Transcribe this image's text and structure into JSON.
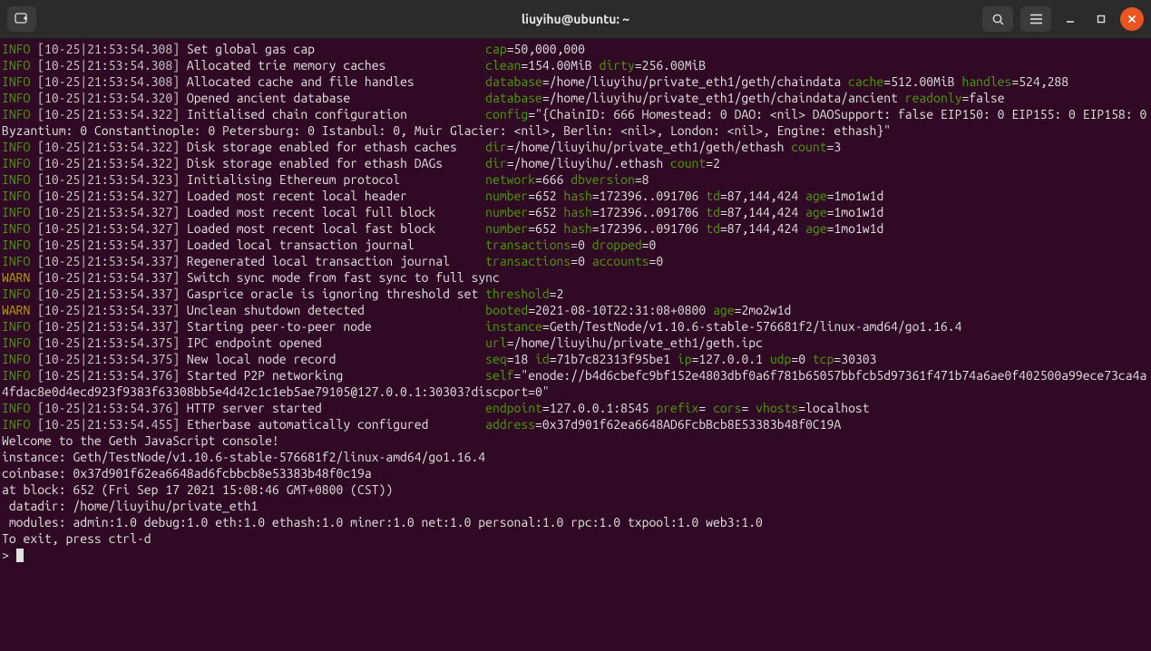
{
  "titlebar": {
    "title": "liuyihu@ubuntu: ~"
  },
  "log": [
    {
      "lvl": "INFO",
      "ts": "[10-25|21:53:54.308]",
      "msg": "Set global gas cap",
      "kv": [
        [
          "cap",
          "50,000,000"
        ]
      ]
    },
    {
      "lvl": "INFO",
      "ts": "[10-25|21:53:54.308]",
      "msg": "Allocated trie memory caches",
      "kv": [
        [
          "clean",
          "154.00MiB"
        ],
        [
          "dirty",
          "256.00MiB"
        ]
      ]
    },
    {
      "lvl": "INFO",
      "ts": "[10-25|21:53:54.308]",
      "msg": "Allocated cache and file handles",
      "kv": [
        [
          "database",
          "/home/liuyihu/private_eth1/geth/chaindata"
        ],
        [
          "cache",
          "512.00MiB"
        ],
        [
          "handles",
          "524,288"
        ]
      ]
    },
    {
      "lvl": "INFO",
      "ts": "[10-25|21:53:54.320]",
      "msg": "Opened ancient database",
      "kv": [
        [
          "database",
          "/home/liuyihu/private_eth1/geth/chaindata/ancient"
        ],
        [
          "readonly",
          "false"
        ]
      ]
    },
    {
      "lvl": "INFO",
      "ts": "[10-25|21:53:54.322]",
      "msg": "Initialised chain configuration",
      "kv": [
        [
          "config",
          "\"{ChainID: 666 Homestead: 0 DAO: <nil> DAOSupport: false EIP150: 0 EIP155: 0 EIP158: 0 Byzantium: 0 Constantinople: 0 Petersburg: 0 Istanbul: 0, Muir Glacier: <nil>, Berlin: <nil>, London: <nil>, Engine: ethash}\""
        ]
      ]
    },
    {
      "lvl": "INFO",
      "ts": "[10-25|21:53:54.322]",
      "msg": "Disk storage enabled for ethash caches",
      "kv": [
        [
          "dir",
          "/home/liuyihu/private_eth1/geth/ethash"
        ],
        [
          "count",
          "3"
        ]
      ]
    },
    {
      "lvl": "INFO",
      "ts": "[10-25|21:53:54.322]",
      "msg": "Disk storage enabled for ethash DAGs",
      "kv": [
        [
          "dir",
          "/home/liuyihu/.ethash"
        ],
        [
          "count",
          "2"
        ]
      ]
    },
    {
      "lvl": "INFO",
      "ts": "[10-25|21:53:54.323]",
      "msg": "Initialising Ethereum protocol",
      "kv": [
        [
          "network",
          "666"
        ],
        [
          "dbversion",
          "8"
        ]
      ]
    },
    {
      "lvl": "INFO",
      "ts": "[10-25|21:53:54.327]",
      "msg": "Loaded most recent local header",
      "kv": [
        [
          "number",
          "652"
        ],
        [
          "hash",
          "172396..091706"
        ],
        [
          "td",
          "87,144,424"
        ],
        [
          "age",
          "1mo1w1d"
        ]
      ]
    },
    {
      "lvl": "INFO",
      "ts": "[10-25|21:53:54.327]",
      "msg": "Loaded most recent local full block",
      "kv": [
        [
          "number",
          "652"
        ],
        [
          "hash",
          "172396..091706"
        ],
        [
          "td",
          "87,144,424"
        ],
        [
          "age",
          "1mo1w1d"
        ]
      ]
    },
    {
      "lvl": "INFO",
      "ts": "[10-25|21:53:54.327]",
      "msg": "Loaded most recent local fast block",
      "kv": [
        [
          "number",
          "652"
        ],
        [
          "hash",
          "172396..091706"
        ],
        [
          "td",
          "87,144,424"
        ],
        [
          "age",
          "1mo1w1d"
        ]
      ]
    },
    {
      "lvl": "INFO",
      "ts": "[10-25|21:53:54.337]",
      "msg": "Loaded local transaction journal",
      "kv": [
        [
          "transactions",
          "0"
        ],
        [
          "dropped",
          "0"
        ]
      ]
    },
    {
      "lvl": "INFO",
      "ts": "[10-25|21:53:54.337]",
      "msg": "Regenerated local transaction journal",
      "kv": [
        [
          "transactions",
          "0"
        ],
        [
          "accounts",
          "0"
        ]
      ]
    },
    {
      "lvl": "WARN",
      "ts": "[10-25|21:53:54.337]",
      "msg": "Switch sync mode from fast sync to full sync",
      "kv": []
    },
    {
      "lvl": "INFO",
      "ts": "[10-25|21:53:54.337]",
      "msg": "Gasprice oracle is ignoring threshold set",
      "kv": [
        [
          "threshold",
          "2"
        ]
      ]
    },
    {
      "lvl": "WARN",
      "ts": "[10-25|21:53:54.337]",
      "msg": "Unclean shutdown detected",
      "kv": [
        [
          "booted",
          "2021-08-10T22:31:08+0800"
        ],
        [
          "age",
          "2mo2w1d"
        ]
      ]
    },
    {
      "lvl": "INFO",
      "ts": "[10-25|21:53:54.337]",
      "msg": "Starting peer-to-peer node",
      "kv": [
        [
          "instance",
          "Geth/TestNode/v1.10.6-stable-576681f2/linux-amd64/go1.16.4"
        ]
      ]
    },
    {
      "lvl": "INFO",
      "ts": "[10-25|21:53:54.375]",
      "msg": "IPC endpoint opened",
      "kv": [
        [
          "url",
          "/home/liuyihu/private_eth1/geth.ipc"
        ]
      ]
    },
    {
      "lvl": "INFO",
      "ts": "[10-25|21:53:54.375]",
      "msg": "New local node record",
      "kv": [
        [
          "seq",
          "18"
        ],
        [
          "id",
          "71b7c82313f95be1"
        ],
        [
          "ip",
          "127.0.0.1"
        ],
        [
          "udp",
          "0"
        ],
        [
          "tcp",
          "30303"
        ]
      ]
    },
    {
      "lvl": "INFO",
      "ts": "[10-25|21:53:54.376]",
      "msg": "Started P2P networking",
      "kv": [
        [
          "self",
          "\"enode://b4d6cbefc9bf152e4803dbf0a6f781b65057bbfcb5d97361f471b74a6ae0f402500a99ece73ca4a4fdac8e0d4ecd923f9383f63308bb5e4d42c1c1eb5ae79105@127.0.0.1:30303?discport=0\""
        ]
      ]
    },
    {
      "lvl": "INFO",
      "ts": "[10-25|21:53:54.376]",
      "msg": "HTTP server started",
      "kv": [
        [
          "endpoint",
          "127.0.0.1:8545"
        ],
        [
          "prefix",
          ""
        ],
        [
          "cors",
          ""
        ],
        [
          "vhosts",
          "localhost"
        ]
      ]
    },
    {
      "lvl": "INFO",
      "ts": "[10-25|21:53:54.455]",
      "msg": "Etherbase automatically configured",
      "kv": [
        [
          "address",
          "0x37d901f62ea6648AD6FcbBcb8E53383b48f0C19A"
        ]
      ]
    }
  ],
  "footer": [
    "Welcome to the Geth JavaScript console!",
    "",
    "instance: Geth/TestNode/v1.10.6-stable-576681f2/linux-amd64/go1.16.4",
    "coinbase: 0x37d901f62ea6648ad6fcbbcb8e53383b48f0c19a",
    "at block: 652 (Fri Sep 17 2021 15:08:46 GMT+0800 (CST))",
    " datadir: /home/liuyihu/private_eth1",
    " modules: admin:1.0 debug:1.0 eth:1.0 ethash:1.0 miner:1.0 net:1.0 personal:1.0 rpc:1.0 txpool:1.0 web3:1.0",
    "",
    "To exit, press ctrl-d"
  ],
  "prompt": "> "
}
